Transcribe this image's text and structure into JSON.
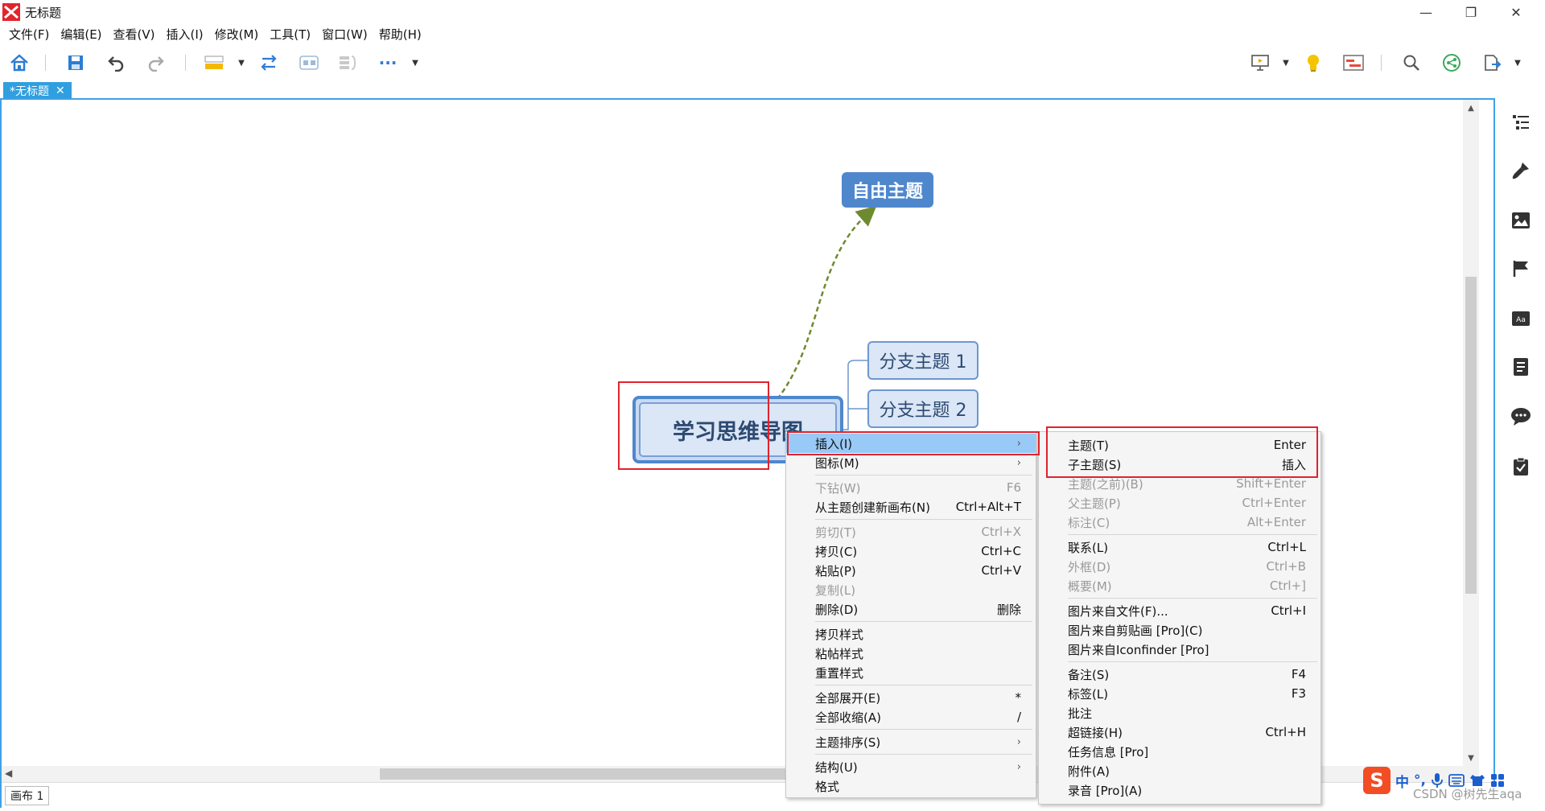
{
  "window": {
    "title": "无标题",
    "minimize": "—",
    "maximize": "❐",
    "close": "✕"
  },
  "menubar": [
    "文件(F)",
    "编辑(E)",
    "查看(V)",
    "插入(I)",
    "修改(M)",
    "工具(T)",
    "窗口(W)",
    "帮助(H)"
  ],
  "toolbar": {
    "icons": [
      "home-icon",
      "save-icon",
      "undo-icon",
      "redo-icon",
      "topic-style-icon",
      "relationship-icon",
      "boundary-icon",
      "summary-icon",
      "more-icon",
      "presentation-icon",
      "idea-icon",
      "gantt-icon",
      "search-icon",
      "share-icon",
      "export-icon"
    ],
    "more_label": "···"
  },
  "tab": {
    "label": "*无标题",
    "close": "✕"
  },
  "mindmap": {
    "free_topic": "自由主题",
    "central_topic": "学习思维导图",
    "branches": [
      "分支主题 1",
      "分支主题 2"
    ]
  },
  "status": {
    "sheet": "画布 1"
  },
  "context_menu": {
    "items": [
      {
        "label": "插入(I)",
        "shortcut": "›",
        "state": "selected"
      },
      {
        "label": "图标(M)",
        "shortcut": "›",
        "state": "normal"
      },
      {
        "sep": true
      },
      {
        "label": "下钻(W)",
        "shortcut": "F6",
        "state": "disabled"
      },
      {
        "label": "从主题创建新画布(N)",
        "shortcut": "Ctrl+Alt+T",
        "state": "normal"
      },
      {
        "sep": true
      },
      {
        "label": "剪切(T)",
        "shortcut": "Ctrl+X",
        "state": "disabled"
      },
      {
        "label": "拷贝(C)",
        "shortcut": "Ctrl+C",
        "state": "normal"
      },
      {
        "label": "粘贴(P)",
        "shortcut": "Ctrl+V",
        "state": "normal"
      },
      {
        "label": "复制(L)",
        "shortcut": "",
        "state": "disabled"
      },
      {
        "label": "删除(D)",
        "shortcut": "删除",
        "state": "normal"
      },
      {
        "sep": true
      },
      {
        "label": "拷贝样式",
        "shortcut": "",
        "state": "normal"
      },
      {
        "label": "粘帖样式",
        "shortcut": "",
        "state": "normal"
      },
      {
        "label": "重置样式",
        "shortcut": "",
        "state": "normal"
      },
      {
        "sep": true
      },
      {
        "label": "全部展开(E)",
        "shortcut": "*",
        "state": "normal"
      },
      {
        "label": "全部收缩(A)",
        "shortcut": "/",
        "state": "normal"
      },
      {
        "sep": true
      },
      {
        "label": "主题排序(S)",
        "shortcut": "›",
        "state": "normal"
      },
      {
        "sep": true
      },
      {
        "label": "结构(U)",
        "shortcut": "›",
        "state": "normal"
      },
      {
        "label": "格式",
        "shortcut": "",
        "state": "normal"
      }
    ]
  },
  "submenu": {
    "items": [
      {
        "label": "主题(T)",
        "shortcut": "Enter",
        "state": "normal"
      },
      {
        "label": "子主题(S)",
        "shortcut": "插入",
        "state": "normal"
      },
      {
        "label": "主题(之前)(B)",
        "shortcut": "Shift+Enter",
        "state": "disabled"
      },
      {
        "label": "父主题(P)",
        "shortcut": "Ctrl+Enter",
        "state": "disabled"
      },
      {
        "label": "标注(C)",
        "shortcut": "Alt+Enter",
        "state": "disabled"
      },
      {
        "sep": true
      },
      {
        "label": "联系(L)",
        "shortcut": "Ctrl+L",
        "state": "normal"
      },
      {
        "label": "外框(D)",
        "shortcut": "Ctrl+B",
        "state": "disabled"
      },
      {
        "label": "概要(M)",
        "shortcut": "Ctrl+]",
        "state": "disabled"
      },
      {
        "sep": true
      },
      {
        "label": "图片来自文件(F)...",
        "shortcut": "Ctrl+I",
        "state": "normal"
      },
      {
        "label": "图片来自剪贴画 [Pro](C)",
        "shortcut": "",
        "state": "normal"
      },
      {
        "label": "图片来自Iconfinder [Pro]",
        "shortcut": "",
        "state": "normal"
      },
      {
        "sep": true
      },
      {
        "label": "备注(S)",
        "shortcut": "F4",
        "state": "normal"
      },
      {
        "label": "标签(L)",
        "shortcut": "F3",
        "state": "normal"
      },
      {
        "label": "批注",
        "shortcut": "",
        "state": "normal"
      },
      {
        "label": "超链接(H)",
        "shortcut": "Ctrl+H",
        "state": "normal"
      },
      {
        "label": "任务信息 [Pro]",
        "shortcut": "",
        "state": "normal"
      },
      {
        "label": "附件(A)",
        "shortcut": "",
        "state": "normal"
      },
      {
        "label": "录音 [Pro](A)",
        "shortcut": "",
        "state": "normal"
      }
    ]
  },
  "right_panel": [
    "outline-icon",
    "format-brush-icon",
    "image-icon",
    "marker-flag-icon",
    "theme-icon",
    "notes-icon",
    "comment-icon",
    "task-icon"
  ],
  "ime": {
    "logo": "S",
    "mode": "中",
    "punct": "°,",
    "watermark": "CSDN @树先生aqa"
  }
}
